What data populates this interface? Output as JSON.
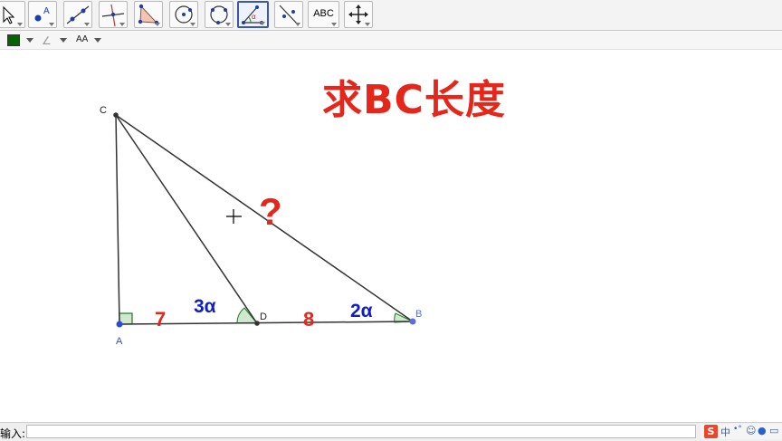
{
  "toolbar": {
    "tools": [
      {
        "name": "move-tool",
        "icon": "arrow-pointer-icon"
      },
      {
        "name": "point-tool",
        "icon": "point-icon",
        "label": "A"
      },
      {
        "name": "line-tool",
        "icon": "line-through-two-points-icon"
      },
      {
        "name": "perpendicular-tool",
        "icon": "perpendicular-line-icon"
      },
      {
        "name": "polygon-tool",
        "icon": "polygon-icon"
      },
      {
        "name": "circle-tool",
        "icon": "circle-center-point-icon"
      },
      {
        "name": "circle-three-points-tool",
        "icon": "circle-three-points-icon"
      },
      {
        "name": "angle-tool",
        "icon": "angle-icon",
        "label": "α",
        "active": true
      },
      {
        "name": "reflect-tool",
        "icon": "reflect-about-line-icon"
      },
      {
        "name": "text-tool",
        "icon": "text-icon",
        "label": "ABC"
      },
      {
        "name": "move-view-tool",
        "icon": "move-graphics-view-icon"
      }
    ]
  },
  "stylebar": {
    "color": "#006400",
    "line_style_icon": "angle-style-icon",
    "text_size_label": "AA"
  },
  "canvas": {
    "title": "求BC长度",
    "title_color": "#e5261a",
    "points": {
      "C": "C",
      "A": "A",
      "D": "D",
      "B": "B"
    },
    "question_mark": "?",
    "labels": {
      "ad": "7",
      "db": "8",
      "angle_cda": "3α",
      "angle_b": "2α"
    },
    "colors": {
      "number": "#e5261a",
      "angle": "#1020c0",
      "segment": "#333333",
      "point_b": "#5a70d8",
      "point_a": "#2a4fd6"
    }
  },
  "input_bar": {
    "label": "输入:",
    "value": ""
  },
  "tray": {
    "ime_logo": "S",
    "lang": "中",
    "punct": "•°",
    "emoji_icon": "smiley-icon",
    "mic_icon": "microphone-icon",
    "keyboard_icon": "keyboard-icon"
  }
}
